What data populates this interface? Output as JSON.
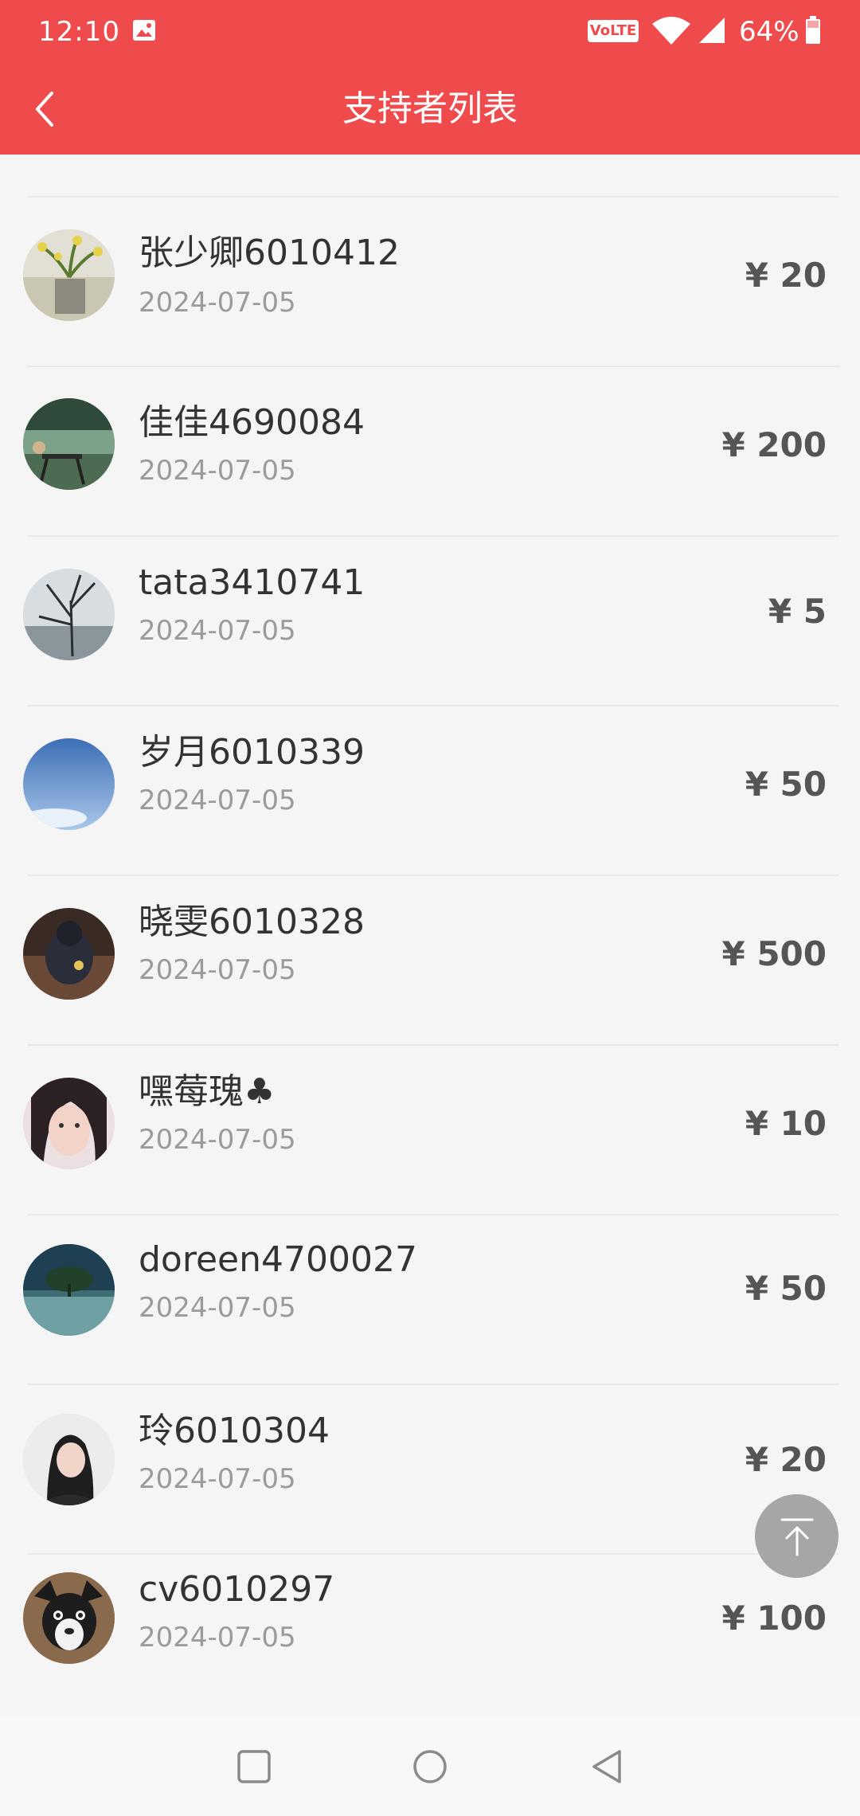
{
  "status_bar": {
    "time": "12:10",
    "volte": "VoLTE",
    "battery": "64%"
  },
  "header": {
    "title": "支持者列表"
  },
  "supporters": [
    {
      "name": "张少卿6010412",
      "date": "2024-07-05",
      "amount": "¥ 20",
      "avatar": "orchid-plant-photo"
    },
    {
      "name": "佳佳4690084",
      "date": "2024-07-05",
      "amount": "¥ 200",
      "avatar": "garden-table-photo"
    },
    {
      "name": "tata3410741",
      "date": "2024-07-05",
      "amount": "¥ 5",
      "avatar": "tree-by-sea-photo"
    },
    {
      "name": "岁月6010339",
      "date": "2024-07-05",
      "amount": "¥ 50",
      "avatar": "blue-sky-photo"
    },
    {
      "name": "晓雯6010328",
      "date": "2024-07-05",
      "amount": "¥ 500",
      "avatar": "person-in-hoodie-photo"
    },
    {
      "name": "嘿莓瑰♣",
      "date": "2024-07-05",
      "amount": "¥ 10",
      "avatar": "girl-portrait-photo"
    },
    {
      "name": "doreen4700027",
      "date": "2024-07-05",
      "amount": "¥ 50",
      "avatar": "tree-on-lake-photo"
    },
    {
      "name": "玲6010304",
      "date": "2024-07-05",
      "amount": "¥ 20",
      "avatar": "woman-portrait-photo"
    },
    {
      "name": "cv6010297",
      "date": "2024-07-05",
      "amount": "¥ 100",
      "avatar": "dog-photo"
    }
  ],
  "icons": {
    "back": "chevron-left-icon",
    "back_to_top": "arrow-up-to-top-icon",
    "nav_recents": "square-icon",
    "nav_home": "circle-icon",
    "nav_back": "triangle-back-icon"
  },
  "colors": {
    "header_bg": "#ef4b4d",
    "name_text": "#333333",
    "date_text": "#9b9b9b",
    "amount_text": "#555555",
    "back_to_top_bg": "#a6a6a6"
  }
}
